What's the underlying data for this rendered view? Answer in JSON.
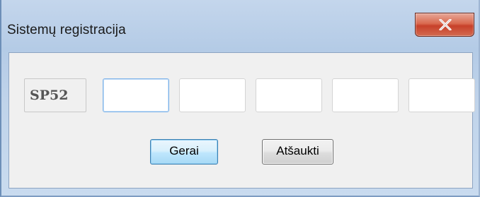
{
  "window": {
    "title": "Sistemų registracija"
  },
  "titlebar": {
    "close_icon": "close-x-icon"
  },
  "registration": {
    "prefix": "SP52",
    "segments": [
      {
        "value": "",
        "focused": true
      },
      {
        "value": "",
        "focused": false
      },
      {
        "value": "",
        "focused": false
      },
      {
        "value": "",
        "focused": false
      },
      {
        "value": "",
        "focused": false
      }
    ]
  },
  "buttons": {
    "ok_label": "Gerai",
    "cancel_label": "Atšaukti"
  },
  "colors": {
    "titlebar": "#b4cbe6",
    "close_button": "#c7412a",
    "dialog_face": "#f0f0f0",
    "focus_border": "#7eb4ea",
    "default_button": "#bee6fd"
  }
}
